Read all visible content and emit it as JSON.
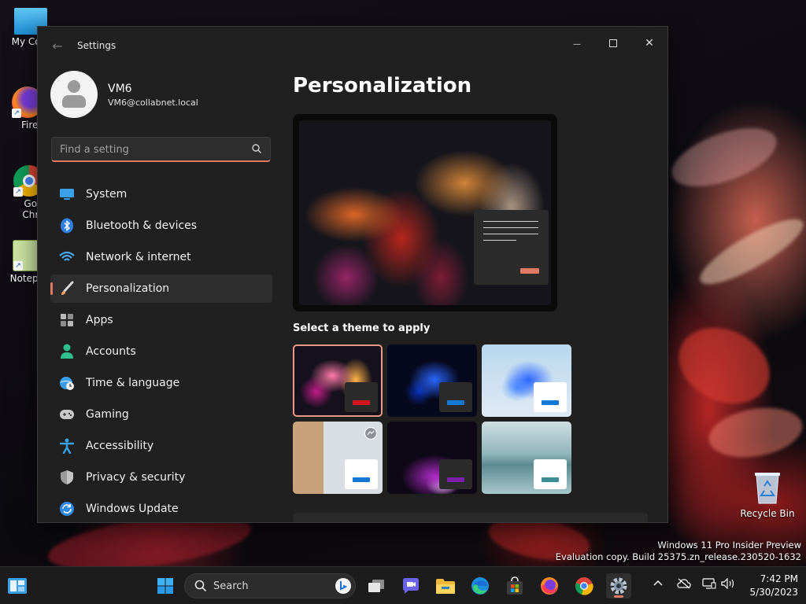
{
  "desktop": {
    "icons": [
      {
        "label": "My Com"
      },
      {
        "label": "Firefo"
      },
      {
        "label": "Goog"
      },
      {
        "label": "Chron"
      },
      {
        "label": "Notepa"
      }
    ],
    "recycle_bin": "Recycle Bin",
    "watermark": {
      "line1": "Windows 11 Pro Insider Preview",
      "line2": "Evaluation copy. Build 25375.zn_release.230520-1632"
    }
  },
  "window": {
    "title": "Settings",
    "back_glyph": "←",
    "min_glyph": "—",
    "close_glyph": "✕"
  },
  "profile": {
    "name": "VM6",
    "email": "VM6@collabnet.local"
  },
  "search": {
    "placeholder": "Find a setting",
    "value": ""
  },
  "nav": {
    "items": [
      {
        "label": "System",
        "icon": "monitor-icon"
      },
      {
        "label": "Bluetooth & devices",
        "icon": "bluetooth-icon"
      },
      {
        "label": "Network & internet",
        "icon": "wifi-icon"
      },
      {
        "label": "Personalization",
        "icon": "brush-icon",
        "active": true
      },
      {
        "label": "Apps",
        "icon": "apps-icon"
      },
      {
        "label": "Accounts",
        "icon": "person-icon"
      },
      {
        "label": "Time & language",
        "icon": "globe-clock-icon"
      },
      {
        "label": "Gaming",
        "icon": "gamepad-icon"
      },
      {
        "label": "Accessibility",
        "icon": "accessibility-icon"
      },
      {
        "label": "Privacy & security",
        "icon": "shield-icon"
      },
      {
        "label": "Windows Update",
        "icon": "update-icon"
      }
    ]
  },
  "main": {
    "title": "Personalization",
    "themes_label": "Select a theme to apply"
  },
  "taskbar": {
    "search_label": "Search",
    "time": "7:42 PM",
    "date": "5/30/2023"
  },
  "colors": {
    "accent": "#e07a63",
    "window_bg": "#202020",
    "taskbar_bg": "#1c1c1c"
  }
}
